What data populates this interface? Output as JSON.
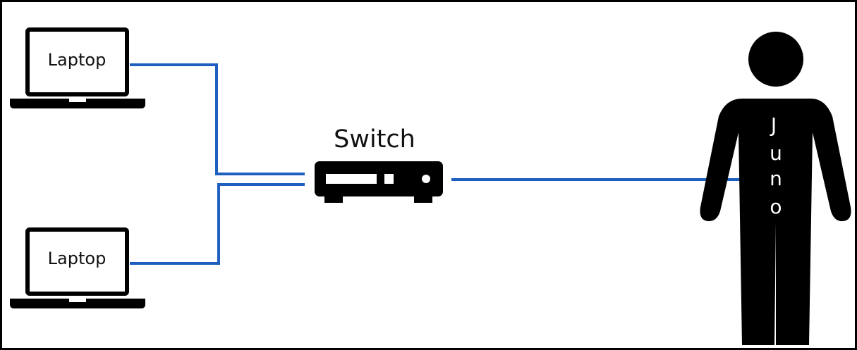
{
  "nodes": {
    "laptop_top": {
      "label": "Laptop",
      "icon": "laptop-icon"
    },
    "laptop_bottom": {
      "label": "Laptop",
      "icon": "laptop-icon"
    },
    "switch": {
      "label": "Switch",
      "icon": "network-switch-icon"
    },
    "person": {
      "label_letters": [
        "J",
        "u",
        "n",
        "o"
      ],
      "icon": "person-icon"
    }
  },
  "colors": {
    "link": "#1f5fbf",
    "device": "#000000",
    "background": "#ffffff",
    "frame": "#000000"
  }
}
